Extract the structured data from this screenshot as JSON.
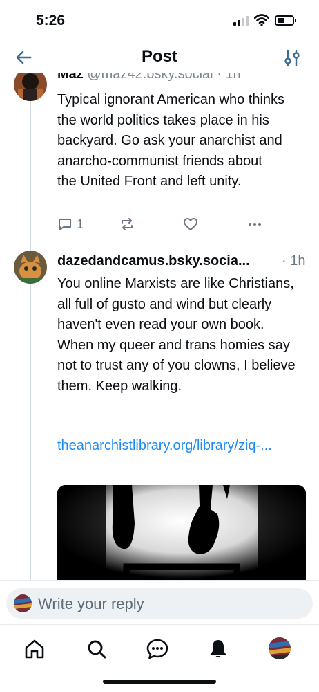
{
  "status_bar": {
    "time": "5:26"
  },
  "header": {
    "title": "Post"
  },
  "colors": {
    "accent": "#1d8bf0",
    "text": "#0b0f14",
    "muted": "#6a7684",
    "thread_line": "#d4dbe2",
    "input_bg": "#eef1f4"
  },
  "posts": [
    {
      "display_name": "Maz",
      "handle": "@maz42.bsky.social",
      "timestamp": "1h",
      "text": "Typical ignorant American who thinks the world politics takes place in his backyard. Go ask your anarchist and anarcho-communist friends about the United Front and left unity.",
      "reply_count": "1",
      "icons": [
        "reply-icon",
        "repost-icon",
        "like-icon",
        "more-icon"
      ]
    },
    {
      "author": "dazedandcamus.bsky.socia...",
      "timestamp": "· 1h",
      "text": "You online Marxists are like Christians, all full of gusto and wind but clearly haven't even read your own book. When my queer and trans homies say not to trust any of you clowns, I believe them.  Keep walking.",
      "link": "theanarchistlibrary.org/library/ziq-..."
    }
  ],
  "reply": {
    "placeholder": "Write your reply"
  },
  "tabs": [
    "home-icon",
    "search-icon",
    "chat-icon",
    "bell-icon",
    "profile-avatar"
  ]
}
